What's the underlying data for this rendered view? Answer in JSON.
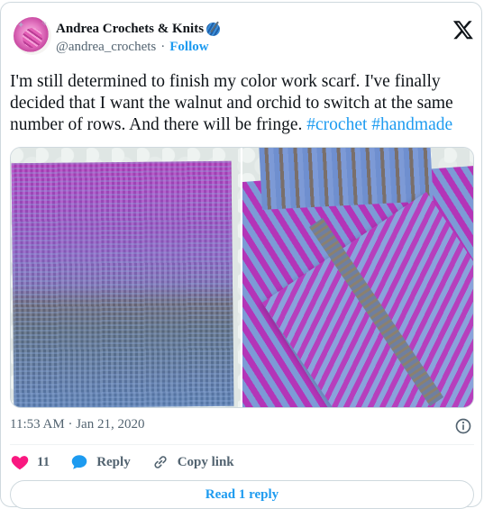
{
  "author": {
    "name": "Andrea Crochets & Knits",
    "handle": "@andrea_crochets",
    "follow_label": "Follow",
    "separator": "·"
  },
  "tweet": {
    "text": "I'm still determined to finish my color work scarf. I've finally decided that I want the walnut and orchid to switch at the same number of rows. And there will be fringe. ",
    "hashtags": [
      "#crochet",
      "#handmade"
    ]
  },
  "meta": {
    "time": "11:53 AM",
    "separator": "·",
    "date": "Jan 21, 2020"
  },
  "actions": {
    "like_count": "11",
    "reply_label": "Reply",
    "copy_link_label": "Copy link"
  },
  "read_reply_label": "Read 1 reply",
  "colors": {
    "accent": "#1d9bf0",
    "like": "#f91880",
    "text": "#0f1419",
    "secondary": "#536471",
    "border": "#cfd9de"
  },
  "icons": {
    "brand": "x-logo-icon",
    "like": "heart-icon",
    "reply": "speech-bubble-icon",
    "copy": "link-icon",
    "info": "info-icon"
  }
}
